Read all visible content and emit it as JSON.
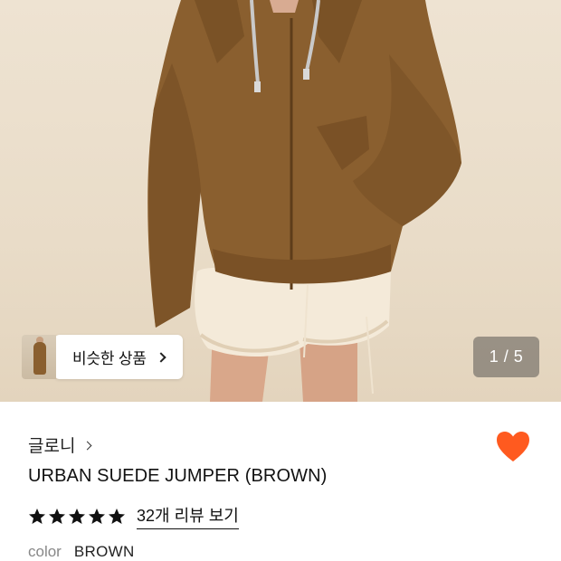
{
  "hero": {
    "colors": {
      "background": "#eee3d2",
      "jacket": "#8a5f2f",
      "shorts": "#f4ead9"
    }
  },
  "similar": {
    "label": "비슷한 상품",
    "icon": "chevron-right-icon"
  },
  "counter": {
    "text": "1 / 5"
  },
  "brand": {
    "name": "글로니",
    "icon": "chevron-right-icon"
  },
  "wishlist": {
    "icon": "heart-icon",
    "color": "#ff5a1f",
    "active": true
  },
  "product": {
    "title": "URBAN SUEDE JUMPER (BROWN)"
  },
  "rating": {
    "stars": 5,
    "review_link": "32개 리뷰 보기"
  },
  "color_option": {
    "label": "color",
    "value": "BROWN"
  }
}
